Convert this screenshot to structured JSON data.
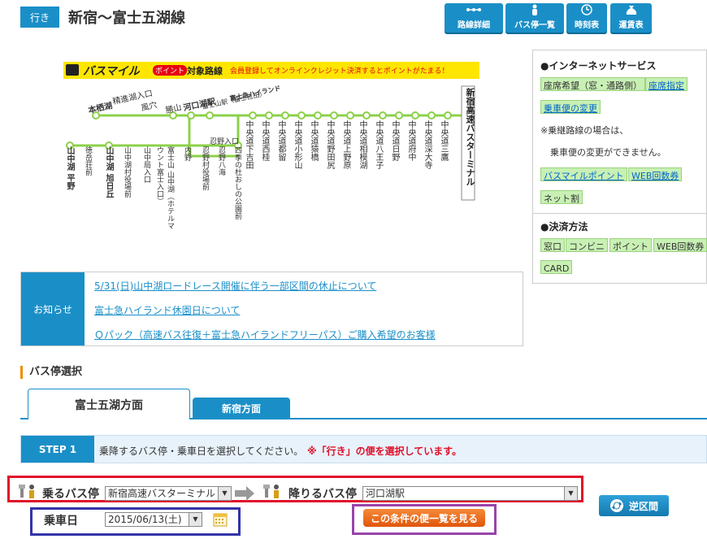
{
  "header": {
    "direction_badge": "行き",
    "route_title": "新宿〜富士五湖線"
  },
  "toolbar": [
    {
      "label": "路線詳細",
      "icon": "route-map-icon"
    },
    {
      "label": "バス停一覧",
      "icon": "person-icon"
    },
    {
      "label": "時刻表",
      "icon": "clock-icon"
    },
    {
      "label": "運賃表",
      "icon": "money-bag-icon"
    }
  ],
  "map": {
    "banner_logo": "バスマイル",
    "banner_point": "ポイント",
    "banner_target": "対象路線",
    "banner_message": "会員登録してオンラインクレジット決済するとポイントがたまる！",
    "terminal": "新宿高速バスターミナル",
    "chuo_stops": [
      "中央道下吉田",
      "中央道西桂",
      "中央道都留",
      "中央道小形山",
      "中央道猿橋",
      "中央道野田尻",
      "中央道上野原",
      "中央道相模湖",
      "中央道八王子",
      "中央道日野",
      "中央道府中",
      "中央道深大寺",
      "中央道三鷹"
    ],
    "upper_stops": [
      "本栖湖",
      "精進湖入口",
      "風穴",
      "勝山",
      "河口湖駅",
      "富士山駅（富士吉田）",
      "富士急ハイランド"
    ],
    "lower_stops": [
      "山中湖 平野",
      "徳岳荘前",
      "山中湖 旭日丘",
      "山中湖村役場前",
      "山中局入口",
      "富士山 山中湖（ホテルマウント富士入口）",
      "内野",
      "忍野入口",
      "忍野村役場前",
      "忍野八海",
      "四季の杜おしの公園前"
    ]
  },
  "internet_service": {
    "title": "●インターネットサービス",
    "chips": [
      "座席希望（窓・通路側）",
      "座席指定",
      "乗車便の変更"
    ],
    "note1": "※乗継路線の場合は、",
    "note2": "乗車便の変更ができません。",
    "chips2": [
      "バスマイルポイント",
      "WEB回数券",
      "ネット割"
    ]
  },
  "payment": {
    "title": "●決済方法",
    "methods": [
      "窓口",
      "コンビニ",
      "ポイント",
      "WEB回数券",
      "CARD"
    ]
  },
  "news": {
    "label": "お知らせ",
    "items": [
      "5/31(日)山中湖ロードレース開催に伴う一部区間の休止について",
      "富士急ハイランド休園日について",
      "Ｑパック（高速バス往復＋富士急ハイランドフリーパス）ご購入希望のお客様"
    ]
  },
  "selection": {
    "section_title": "バス停選択",
    "tab_active": "富士五湖方面",
    "tab_inactive": "新宿方面",
    "step_badge": "STEP 1",
    "step_text": "乗降するバス停・乗車日を選択してください。",
    "step_note": "※「行き」の便を選択しています。",
    "board_label": "乗るバス停",
    "board_value": "新宿高速バスターミナル",
    "alight_label": "降りるバス停",
    "alight_value": "河口湖駅",
    "date_label": "乗車日",
    "date_value": "2015/06/13(土)",
    "search_button": "この条件の便一覧を見る",
    "reverse_button": "逆区間"
  },
  "colors": {
    "primary": "#1a8fc7",
    "route_green": "#8cd14a",
    "chip_green": "#c8f0b4",
    "search_orange": "#f06a10",
    "frame_red": "#e0102a",
    "frame_blue": "#3333aa",
    "frame_purple": "#9944aa"
  }
}
